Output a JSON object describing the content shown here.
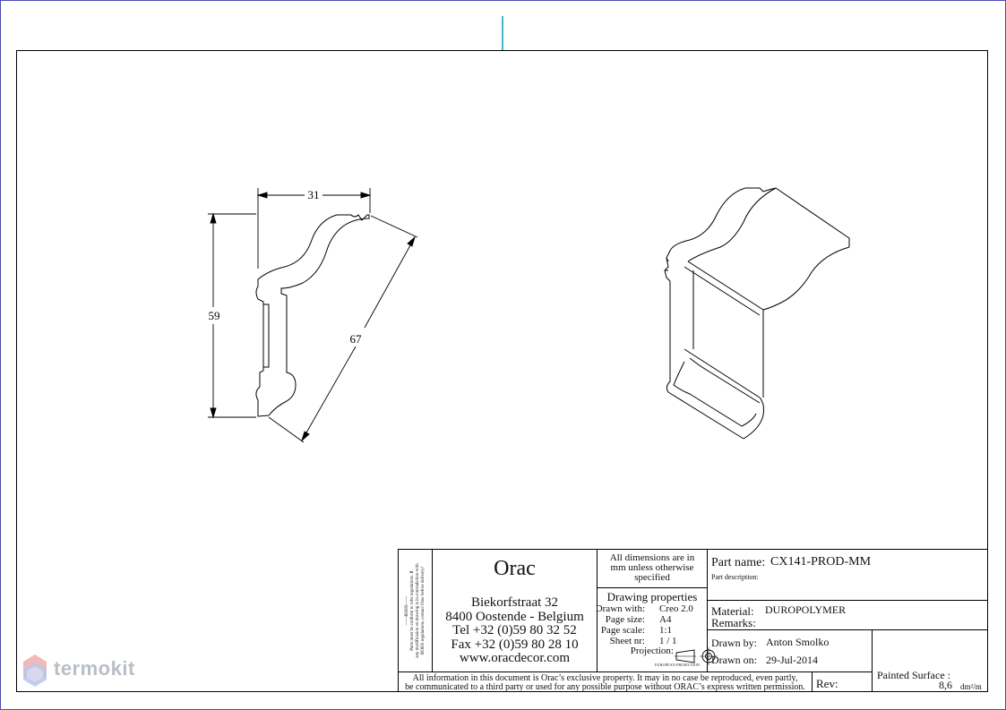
{
  "drawing": {
    "dimensions": {
      "width": "31",
      "height": "59",
      "diagonal": "67"
    }
  },
  "title_block": {
    "rohs_lines": [
      "——ROHS——",
      "Parts must be conform to rohs regulations. If",
      "any modification on drawing is in contradiction with",
      "ROHS regulations, contact Orac before delivery!"
    ],
    "company": {
      "name": "Orac",
      "address_1": "Biekorfstraat 32",
      "address_2": "8400 Oostende - Belgium",
      "tel": "Tel   +32 (0)59 80 32 52",
      "fax": "Fax   +32 (0)59 80 28 10",
      "website": "www.oracdecor.com"
    },
    "dimensions_note": [
      "All dimensions are in",
      "mm unless otherwise",
      "specified"
    ],
    "drawing_properties": {
      "title": "Drawing properties",
      "rows": [
        {
          "label": "Drawn with:",
          "value": "Creo 2.0"
        },
        {
          "label": "Page size:",
          "value": "A4"
        },
        {
          "label": "Page scale:",
          "value": "1:1"
        },
        {
          "label": "Sheet nr:",
          "value": "1 / 1"
        },
        {
          "label": "Projection:",
          "value": ""
        }
      ],
      "projection_caption": "EUROPEAN PROJECTION"
    },
    "part_name_label": "Part name:",
    "part_name": "CX141-PROD-MM",
    "part_description_label": "Part description:",
    "material_label": "Material:",
    "material": "DUROPOLYMER",
    "remarks_label": "Remarks:",
    "drawn_by_label": "Drawn by:",
    "drawn_by": "Anton Smolko",
    "drawn_on_label": "Drawn on:",
    "drawn_on": "29-Jul-2014",
    "painted_surface_label": "Painted Surface :",
    "painted_surface_value": "8,6",
    "painted_surface_unit": "dm²/m",
    "rev_label": "Rev:",
    "footer_line_1": "All information in this document is Orac’s exclusive property.  It may in no case be reproduced, even partly,",
    "footer_line_2": "be communicated to a third party or used for any possible purpose without ORAC’s express written permission."
  },
  "watermark": {
    "text": "termokit"
  }
}
